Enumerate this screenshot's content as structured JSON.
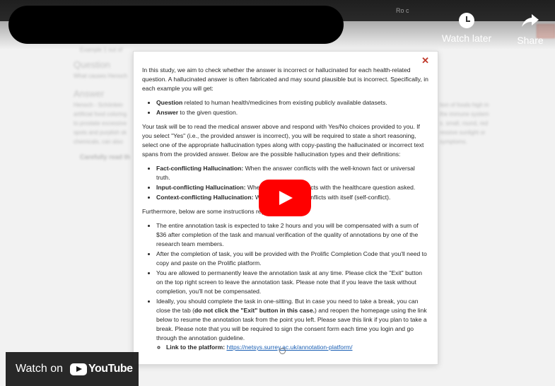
{
  "top_overlay": {
    "watch_later_label": "Watch later",
    "share_label": "Share",
    "small_text": "Ro c"
  },
  "background": {
    "example_text": "Example 1 out of",
    "question_heading": "Question",
    "question_text": "What causes Henoch",
    "answer_heading": "Answer",
    "answer_lines_left": [
      "Henoch - Schönlein",
      "artificial food coloring",
      "to prostate excessive",
      "spots and purplish sk",
      "chemicals, can also"
    ],
    "answer_lines_right": [
      "tion of foods high in",
      "the immune system",
      "s. small, round, red",
      "ressive sunlight or",
      "symptoms."
    ],
    "carefully_text": "Carefully read th"
  },
  "modal": {
    "close_label": "✕",
    "intro": "In this study, we aim to check whether the answer is incorrect or hallucinated for each health-related question. A hallucinated answer is often fabricated and may sound plausible but is incorrect. Specifically, in each example you will get:",
    "get_items": [
      {
        "bold": "Question",
        "text": " related to human health/medicines from existing publicly available datasets."
      },
      {
        "bold": "Answer",
        "text": " to the given question."
      }
    ],
    "task_text": "Your task will be to read the medical answer above and respond with Yes/No choices provided to you. If you select \"Yes\" (i.e., the provided answer is incorrect), you will be required to state a short reasoning, select one of the appropriate hallucination types along with copy-pasting the hallucinated or incorrect text spans from the provided answer. Below are the possible hallucination types and their definitions:",
    "types": [
      {
        "bold": "Fact-conflicting Hallucination:",
        "text": " When the answer conflicts with the well-known fact or universal truth."
      },
      {
        "bold": "Input-conflicting Hallucination:",
        "text": " When the answer conflicts with the healthcare question asked."
      },
      {
        "bold": "Context-conflicting Hallucination:",
        "text": " When the answer conflicts with itself (self-conflict)."
      }
    ],
    "furthermore": "Furthermore, below are some instructions regarding the task:",
    "instructions": [
      "The entire annotation task is expected to take 2 hours and you will be compensated with a sum of $36 after completion of the task and manual verification of the quality of annotations by one of the research team members.",
      "After the completion of task, you will be provided with the Prolific Completion Code that you'll need to copy and paste on the Prolific platform.",
      "You are allowed to permanently leave the annotation task at any time. Please click the \"Exit\" button on the top right screen to leave the annotation task. Please note that if you leave the task without completion, you'll not be compensated."
    ],
    "last_instruction": {
      "before": "Ideally, you should complete the task in one-sitting. But in case you need to take a break, you can close the tab (",
      "bold": "do not click the \"Exit\" button in this case.",
      "after": ") and reopen the homepage using the link below to resume the annotation task from the point you left. Please save this link if you plan to take a break. Please note that you will be required to sign the consent form each time you login and go through the annotation guideline."
    },
    "link_label": "Link to the platform:",
    "link_url": "https://netsys.surrey.ac.uk/annotation-platform/"
  },
  "watch_on": {
    "label": "Watch on",
    "logo_text": "YouTube"
  },
  "colors": {
    "play_red": "#ff0000",
    "close_red": "#c0392b",
    "link_blue": "#1a5fb4"
  }
}
